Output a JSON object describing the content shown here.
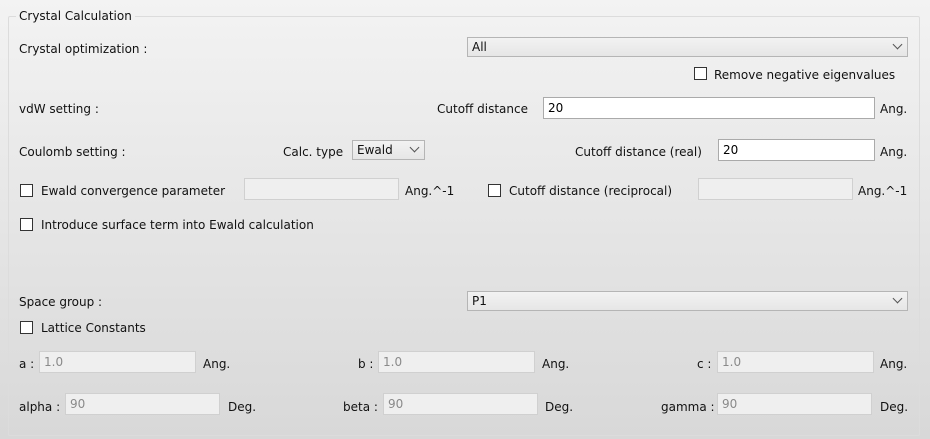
{
  "group": {
    "title": "Crystal Calculation"
  },
  "crystal_opt": {
    "label": "Crystal optimization :",
    "value": "All"
  },
  "remove_neg": {
    "label": "Remove negative eigenvalues",
    "checked": false
  },
  "vdw": {
    "label": "vdW setting :",
    "cutoff_label": "Cutoff distance",
    "cutoff_value": "20",
    "unit": "Ang."
  },
  "coulomb": {
    "label": "Coulomb setting :",
    "calc_type_label": "Calc. type",
    "calc_type_value": "Ewald",
    "cutoff_real_label": "Cutoff distance (real)",
    "cutoff_real_value": "20",
    "unit": "Ang."
  },
  "ewald_conv": {
    "label": "Ewald convergence parameter",
    "value": "",
    "unit": "Ang.^-1"
  },
  "cutoff_recip": {
    "label": "Cutoff distance (reciprocal)",
    "value": "",
    "unit": "Ang.^-1"
  },
  "surface_term": {
    "label": "Introduce surface term into Ewald calculation"
  },
  "space_group": {
    "label": "Space group :",
    "value": "P1"
  },
  "lattice": {
    "label": "Lattice Constants",
    "a_label": "a :",
    "a_value": "1.0",
    "b_label": "b :",
    "b_value": "1.0",
    "c_label": "c :",
    "c_value": "1.0",
    "len_unit": "Ang.",
    "alpha_label": "alpha :",
    "alpha_value": "90",
    "beta_label": "beta :",
    "beta_value": "90",
    "gamma_label": "gamma :",
    "gamma_value": "90",
    "deg_unit": "Deg."
  }
}
